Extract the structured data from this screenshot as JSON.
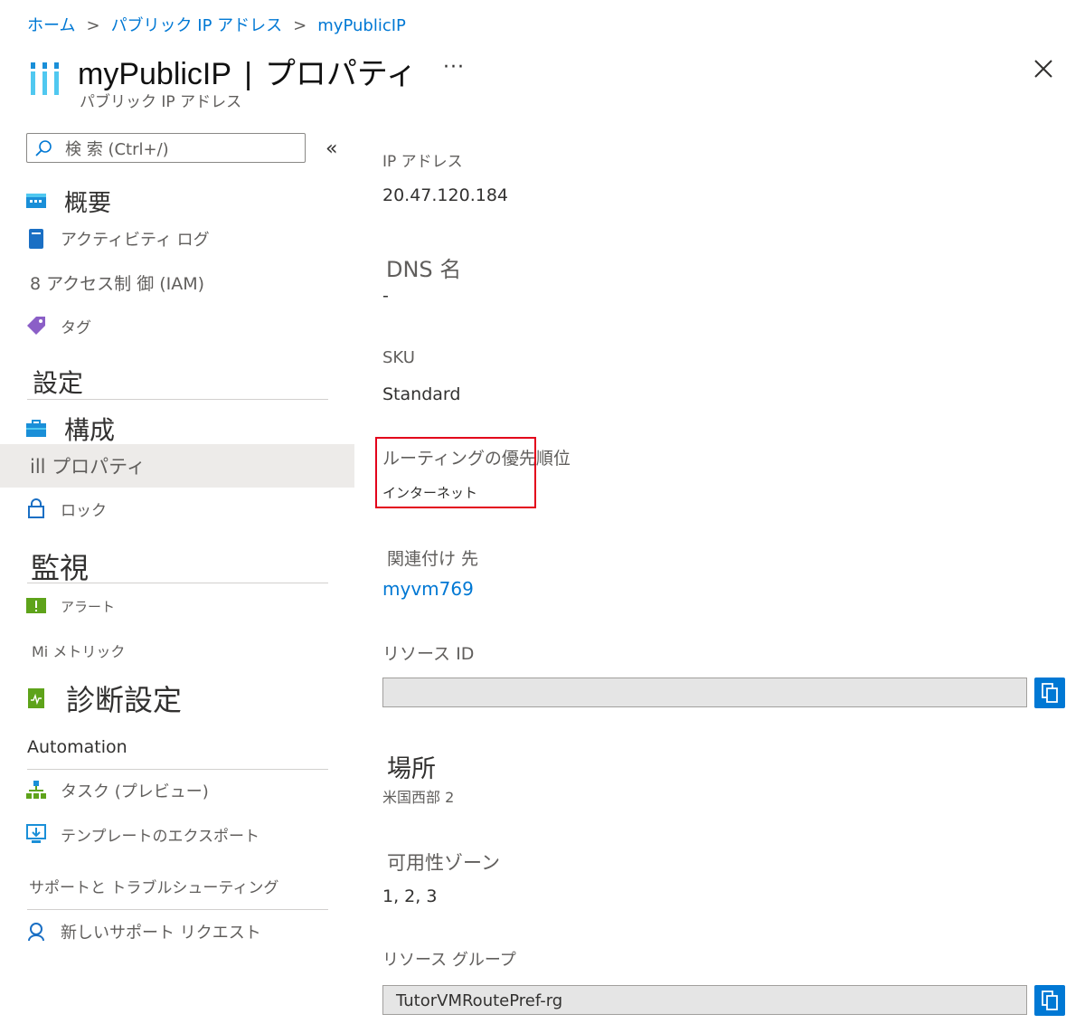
{
  "breadcrumb": {
    "home": "ホーム",
    "parent": "パブリック IP アドレス",
    "current": "myPublicIP",
    "separator": ">"
  },
  "header": {
    "resource_name": "myPublicIP",
    "separator": "|",
    "page_title": "プロパティ",
    "subtitle": "パブリック IP アドレス",
    "more": "···"
  },
  "search": {
    "placeholder": "検 索 (Ctrl+/)"
  },
  "sidebar": {
    "collapse": "«",
    "items": [
      {
        "label": "概要",
        "icon": "overview-icon"
      },
      {
        "label": "アクティビティ ログ",
        "icon": "activity-log-icon"
      },
      {
        "label": "8 アクセス制 御 (IAM)"
      },
      {
        "label": "タグ",
        "icon": "tag-icon"
      }
    ],
    "sections": {
      "settings": "設定",
      "monitoring": "監視",
      "automation": "Automation",
      "support": "サポートと トラブルシューティング"
    },
    "settings_items": [
      {
        "label": "構成",
        "icon": "configuration-icon"
      },
      {
        "label": "ill プロパティ",
        "selected": true
      },
      {
        "label": "ロック",
        "icon": "lock-icon"
      }
    ],
    "monitoring_items": [
      {
        "label": "アラート",
        "icon": "alert-icon"
      },
      {
        "label": "Mi メトリック"
      },
      {
        "label": "診断設定",
        "icon": "diagnostic-settings-icon"
      }
    ],
    "automation_items": [
      {
        "label": "タスク (プレビュー)",
        "icon": "tasks-icon"
      },
      {
        "label": "テンプレートのエクスポート",
        "icon": "export-template-icon"
      }
    ],
    "support_items": [
      {
        "label": "新しいサポート リクエスト",
        "icon": "support-request-icon"
      }
    ]
  },
  "properties": {
    "ip_address": {
      "label": "IP アドレス",
      "value": "20.47.120.184"
    },
    "dns_name": {
      "label": "DNS 名",
      "value": "-"
    },
    "sku": {
      "label": "SKU",
      "value": "Standard"
    },
    "routing_preference": {
      "label": "ルーティングの優先順位",
      "value": "インターネット"
    },
    "associated_to": {
      "label": "関連付け 先",
      "value": "myvm769"
    },
    "resource_id": {
      "label": "リソース ID",
      "value": ""
    },
    "location": {
      "label": "場所",
      "value": "米国西部 2"
    },
    "availability_zone": {
      "label": "可用性ゾーン",
      "value": "1, 2, 3"
    },
    "resource_group": {
      "label": "リソース グループ",
      "value": "TutorVMRoutePref-rg"
    }
  },
  "colors": {
    "accent": "#0078d4",
    "highlight_border": "#e3001b",
    "selected_bg": "#edebe9"
  }
}
